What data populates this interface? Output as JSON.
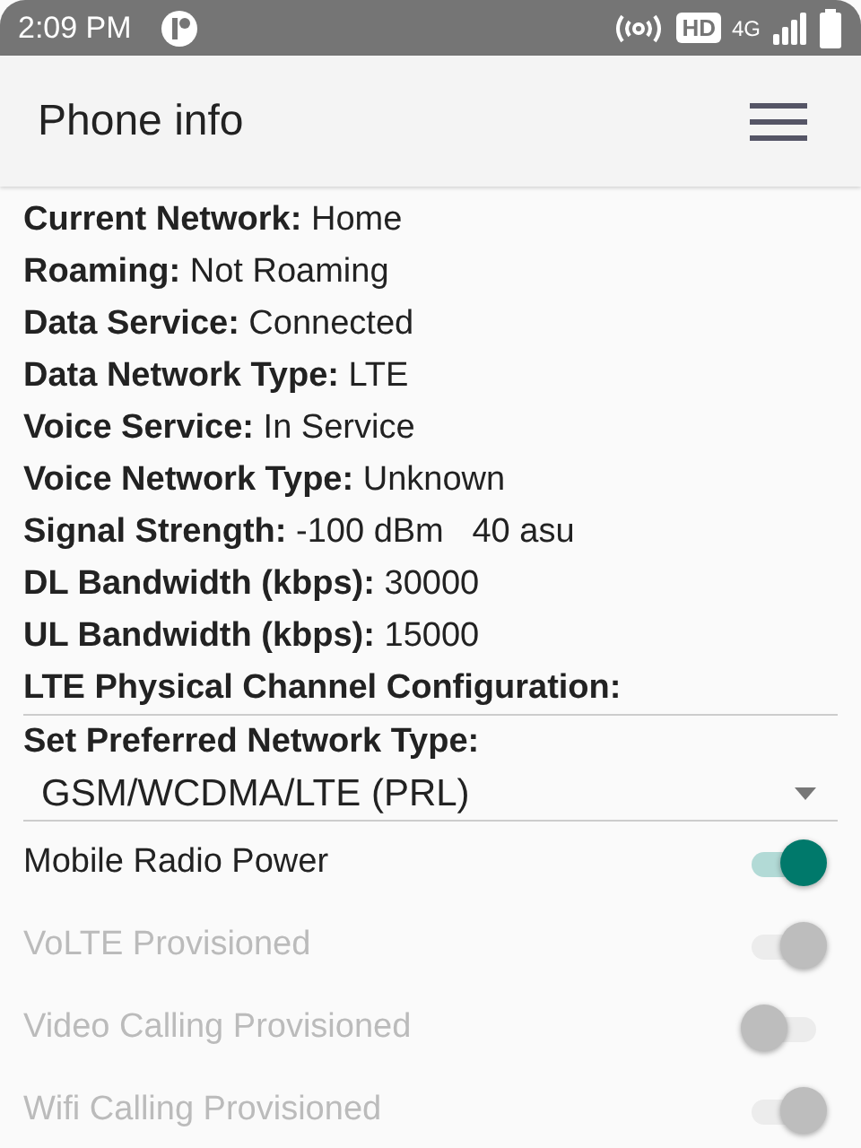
{
  "status_bar": {
    "time": "2:09 PM",
    "hd_badge": "HD",
    "network": "4G"
  },
  "toolbar": {
    "title": "Phone info"
  },
  "info": [
    {
      "label": "Current Network:",
      "value": "Home"
    },
    {
      "label": "Roaming:",
      "value": "Not Roaming"
    },
    {
      "label": "Data Service:",
      "value": "Connected"
    },
    {
      "label": "Data Network Type:",
      "value": "LTE"
    },
    {
      "label": "Voice Service:",
      "value": "In Service"
    },
    {
      "label": "Voice Network Type:",
      "value": "Unknown"
    },
    {
      "label": "Signal Strength:",
      "value": "-100 dBm   40 asu"
    },
    {
      "label": "DL Bandwidth (kbps):",
      "value": "30000"
    },
    {
      "label": "UL Bandwidth (kbps):",
      "value": "15000"
    },
    {
      "label": "LTE Physical Channel Configuration:"
    }
  ],
  "preferred_network": {
    "label": "Set Preferred Network Type:",
    "value": "GSM/WCDMA/LTE (PRL)"
  },
  "switches": [
    {
      "label": "Mobile Radio Power",
      "on": true,
      "disabled": false
    },
    {
      "label": "VoLTE Provisioned",
      "on": true,
      "disabled": true
    },
    {
      "label": "Video Calling Provisioned",
      "on": false,
      "disabled": true
    },
    {
      "label": "Wifi Calling Provisioned",
      "on": true,
      "disabled": true
    }
  ]
}
